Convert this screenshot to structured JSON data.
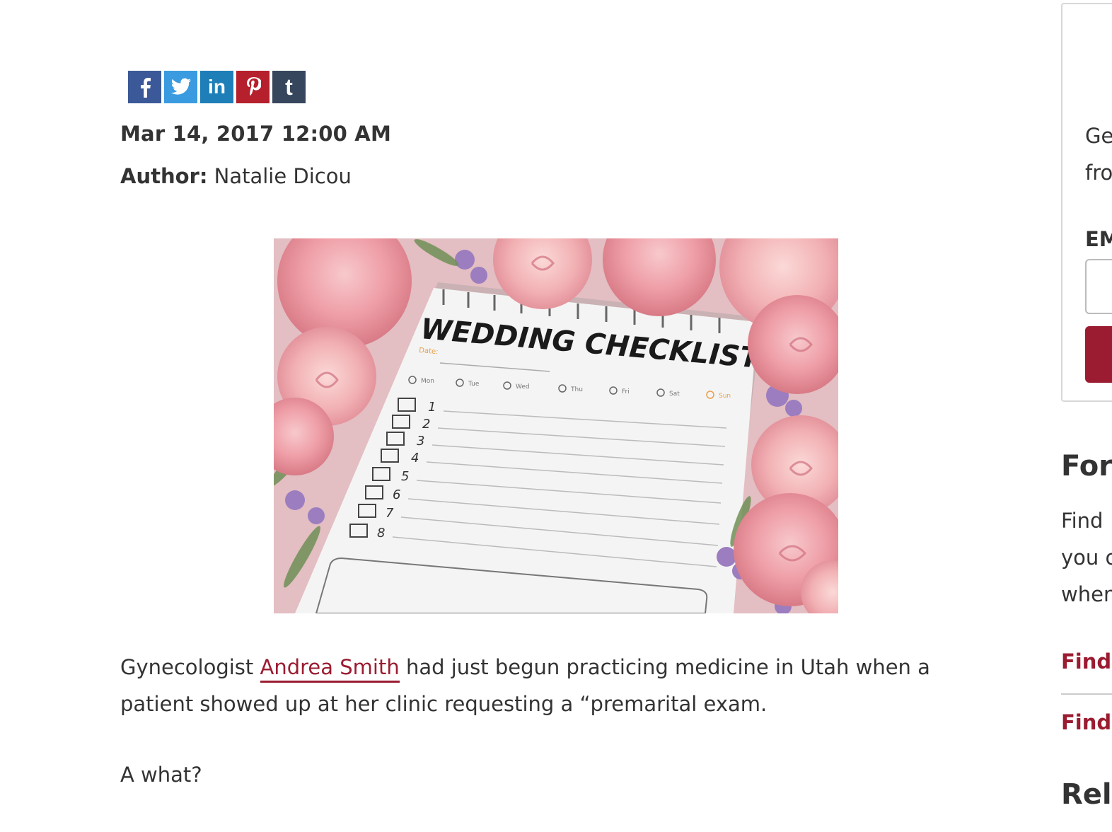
{
  "share": {
    "buttons": [
      {
        "network": "Facebook",
        "glyph": "f",
        "color": "#3b5998",
        "icon": "facebook-icon"
      },
      {
        "network": "Twitter",
        "glyph": "twitter-bird",
        "color": "#3a9be0",
        "icon": "twitter-icon"
      },
      {
        "network": "LinkedIn",
        "glyph": "in",
        "color": "#1e7fb8",
        "icon": "linkedin-icon"
      },
      {
        "network": "Pinterest",
        "glyph": "P",
        "color": "#b5202c",
        "icon": "pinterest-icon"
      },
      {
        "network": "Tumblr",
        "glyph": "t",
        "color": "#36465d",
        "icon": "tumblr-icon"
      }
    ]
  },
  "post": {
    "date": "Mar 14, 2017 12:00 AM",
    "author_label": "Author:",
    "author_name": "Natalie Dicou"
  },
  "hero": {
    "checklist_title": "WEDDING CHECKLIST",
    "date_label": "Date:",
    "days": [
      "Mon",
      "Tue",
      "Wed",
      "Thu",
      "Fri",
      "Sat",
      "Sun"
    ],
    "numbers": [
      "1",
      "2",
      "3",
      "4",
      "5",
      "6",
      "7",
      "8"
    ]
  },
  "article": {
    "p1_before": "Gynecologist ",
    "p1_link": "Andrea Smith",
    "p1_after": " had just begun practicing medicine in Utah when a patient showed up at her clinic requesting a “premarital exam.",
    "p2": "A what?"
  },
  "sidebar": {
    "newsletter_line1": "Ge",
    "newsletter_line2": "fro",
    "email_label": "EM",
    "heading1": "For",
    "text_line1": "Find",
    "text_line2": "you c",
    "text_line3": "when",
    "link1": "Find",
    "link2": "Find",
    "heading2": "Rel"
  },
  "colors": {
    "accent": "#9b1c31",
    "text": "#333333"
  }
}
